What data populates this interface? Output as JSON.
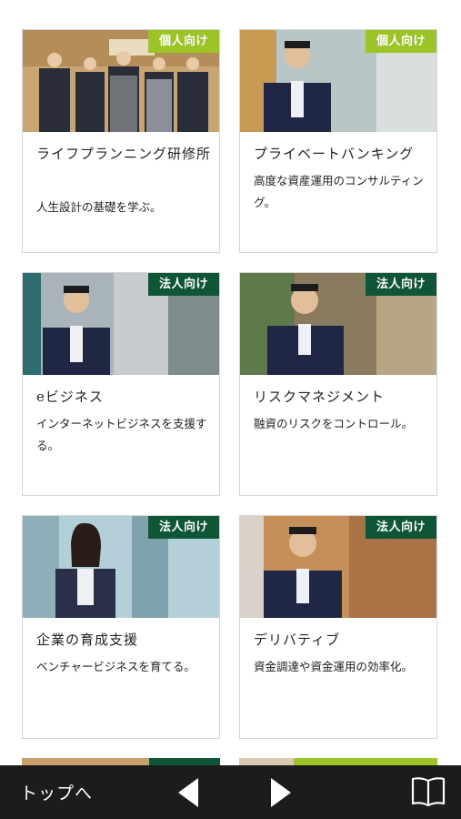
{
  "colors": {
    "personal_badge": "#9cc426",
    "corporate_badge": "#0f5637",
    "bottom_bar": "#1c1c1c"
  },
  "cards": [
    {
      "badge": "個人向け",
      "badge_type": "personal",
      "title": "ライフプランニング研修所",
      "desc": "人生設計の基礎を学ぶ。"
    },
    {
      "badge": "個人向け",
      "badge_type": "personal",
      "title": "プライベートバンキング",
      "desc": "高度な資産運用のコンサルティング。"
    },
    {
      "badge": "法人向け",
      "badge_type": "corporate",
      "title": "eビジネス",
      "desc": "インターネットビジネスを支援する。"
    },
    {
      "badge": "法人向け",
      "badge_type": "corporate",
      "title": "リスクマネジメント",
      "desc": "融資のリスクをコントロール。"
    },
    {
      "badge": "法人向け",
      "badge_type": "corporate",
      "title": "企業の育成支援",
      "desc": "ベンチャービジネスを育てる。"
    },
    {
      "badge": "法人向け",
      "badge_type": "corporate",
      "title": "デリバティブ",
      "desc": "資金調達や資金運用の効率化。"
    }
  ],
  "bottom_bar": {
    "top_link": "トップへ",
    "prev_icon": "triangle-left-icon",
    "next_icon": "triangle-right-icon",
    "book_icon": "open-book-icon"
  }
}
